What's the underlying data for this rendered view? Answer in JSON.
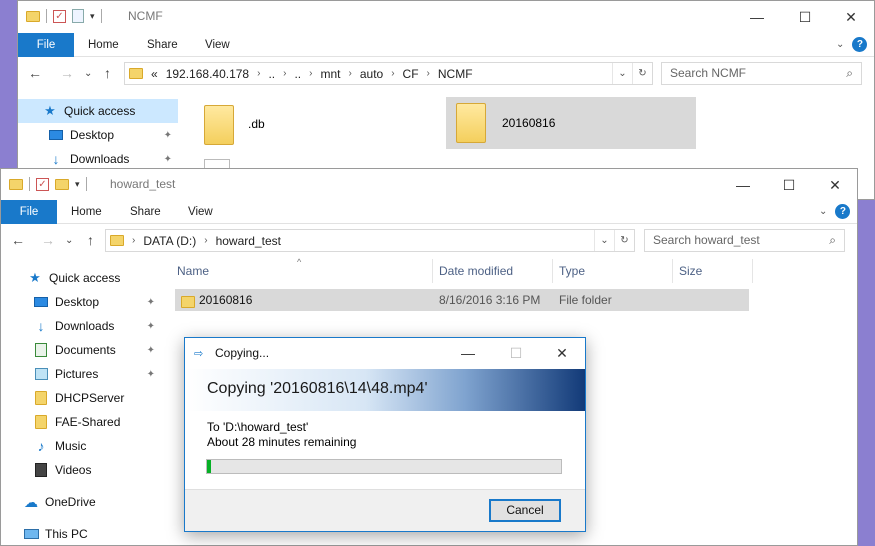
{
  "back_window": {
    "title": "NCMF",
    "ribbon_tabs": [
      "File",
      "Home",
      "Share",
      "View"
    ],
    "address": [
      "«",
      "192.168.40.178",
      "..",
      "..",
      "mnt",
      "auto",
      "CF",
      "NCMF"
    ],
    "search_placeholder": "Search NCMF",
    "nav_items": [
      "Quick access",
      "Desktop",
      "Downloads"
    ],
    "files": [
      ".db",
      "20160816"
    ]
  },
  "front_window": {
    "title": "howard_test",
    "ribbon_tabs": [
      "File",
      "Home",
      "Share",
      "View"
    ],
    "address": [
      "DATA (D:)",
      "howard_test"
    ],
    "search_placeholder": "Search howard_test",
    "nav_items": [
      {
        "label": "Quick access",
        "icon": "star-icon"
      },
      {
        "label": "Desktop",
        "icon": "desktop-icon"
      },
      {
        "label": "Downloads",
        "icon": "download-icon"
      },
      {
        "label": "Documents",
        "icon": "documents-icon"
      },
      {
        "label": "Pictures",
        "icon": "pictures-icon"
      },
      {
        "label": "DHCPServer",
        "icon": "folder-icon"
      },
      {
        "label": "FAE-Shared",
        "icon": "folder-icon"
      },
      {
        "label": "Music",
        "icon": "music-icon"
      },
      {
        "label": "Videos",
        "icon": "videos-icon"
      },
      {
        "label": "OneDrive",
        "icon": "cloud-icon"
      },
      {
        "label": "This PC",
        "icon": "pc-icon"
      }
    ],
    "columns": [
      "Name",
      "Date modified",
      "Type",
      "Size"
    ],
    "rows": [
      {
        "name": "20160816",
        "date": "8/16/2016 3:16 PM",
        "type": "File folder",
        "size": ""
      }
    ]
  },
  "dialog": {
    "title": "Copying...",
    "heading": "Copying '20160816\\14\\48.mp4'",
    "destination": "To 'D:\\howard_test'",
    "remaining": "About 28 minutes remaining",
    "progress_fraction": 0.012,
    "cancel_label": "Cancel"
  },
  "colors": {
    "accent": "#1979ca",
    "progress": "#06b025",
    "selection": "#d9d9d9"
  }
}
